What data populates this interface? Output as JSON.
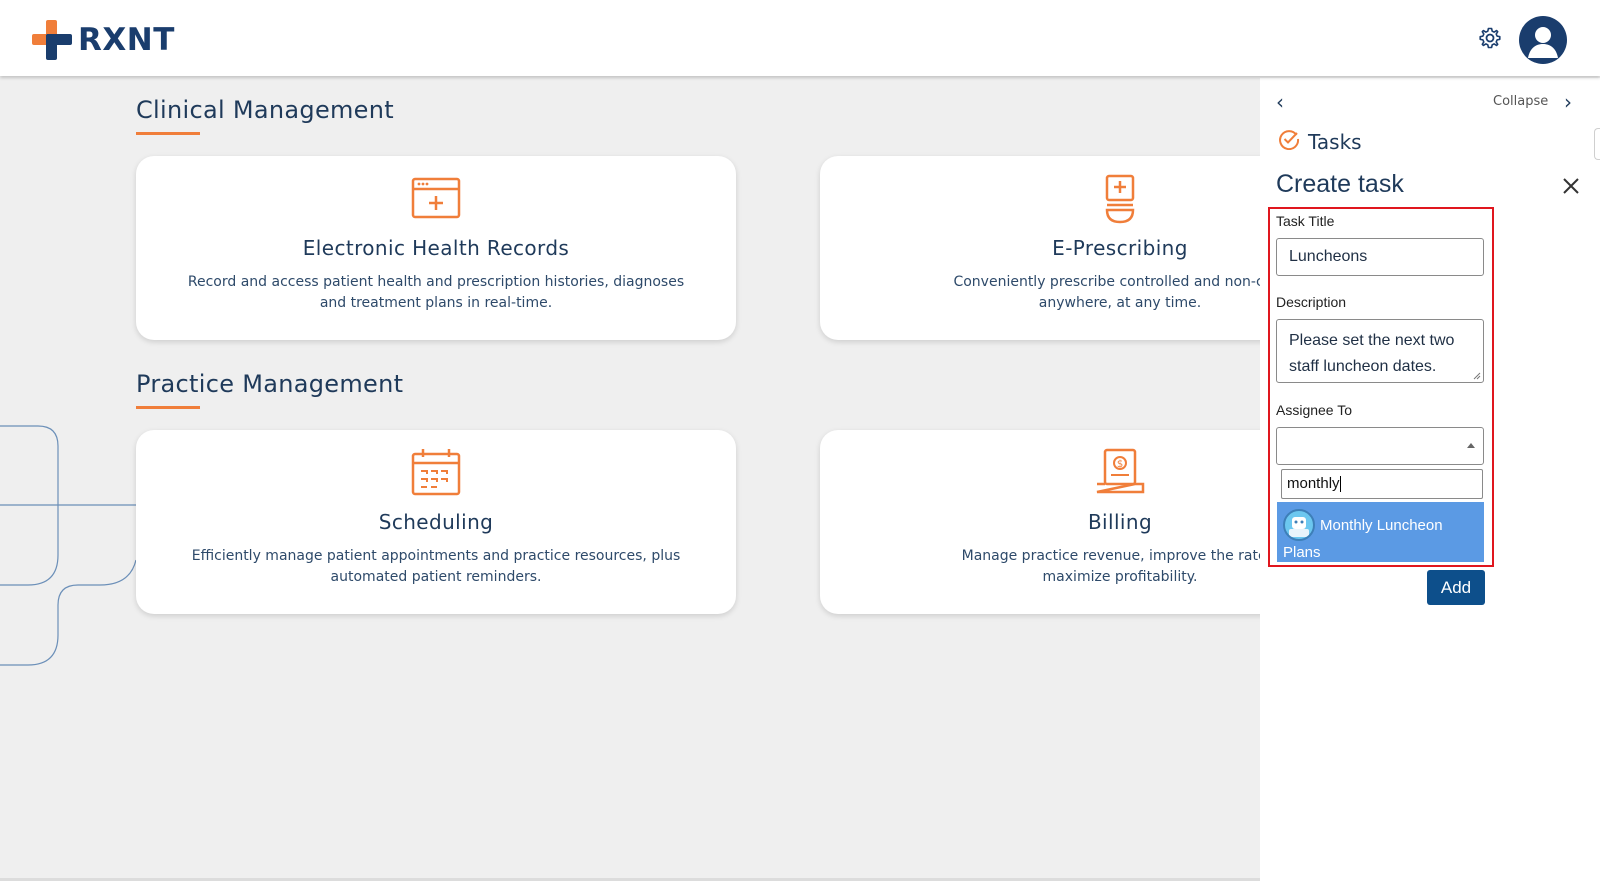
{
  "brand": {
    "name": "RXNT",
    "orange": "#f07e3a",
    "navy": "#1a3d6d"
  },
  "header": {
    "settings_icon": "gear-icon",
    "profile_icon": "user-avatar-icon"
  },
  "sections": [
    {
      "title": "Clinical Management",
      "cards": [
        {
          "title": "Electronic Health Records",
          "desc": "Record and access patient health and prescription histories, diagnoses and treatment plans in real-time.",
          "icon": "medical-calendar-icon"
        },
        {
          "title": "E-Prescribing",
          "desc_line1": "Conveniently prescribe controlled and non-controlled su",
          "desc_line2": "anywhere, at any time.",
          "icon": "prescription-bottle-icon"
        }
      ]
    },
    {
      "title": "Practice Management",
      "cards": [
        {
          "title": "Scheduling",
          "desc": "Efficiently manage patient appointments and practice resources, plus automated patient reminders.",
          "icon": "calendar-icon"
        },
        {
          "title": "Billing",
          "desc_line1": "Manage practice revenue, improve the rate of reimbu",
          "desc_line2": "maximize profitability.",
          "icon": "billing-laptop-icon"
        }
      ]
    }
  ],
  "panel": {
    "collapse_label": "Collapse",
    "tasks_label": "Tasks",
    "create_title": "Create task",
    "task_title_label": "Task Title",
    "task_title_value": "Luncheons",
    "description_label": "Description",
    "description_value": "Please set the next two staff luncheon dates.",
    "assignee_label": "Assignee To",
    "assignee_value": "",
    "search_value": "monthly",
    "option_line1": "Monthly Luncheon",
    "option_line2": "Plans",
    "add_label": "Add"
  }
}
